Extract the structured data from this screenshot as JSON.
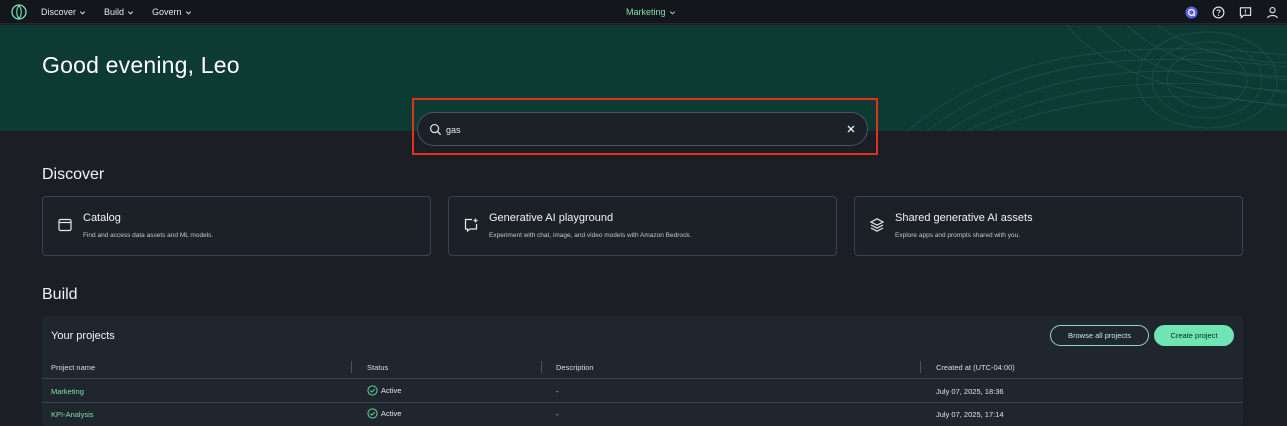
{
  "nav": {
    "items": [
      {
        "label": "Discover"
      },
      {
        "label": "Build"
      },
      {
        "label": "Govern"
      }
    ],
    "project_switch": "Marketing"
  },
  "hero": {
    "greeting": "Good evening, Leo"
  },
  "search": {
    "value": "gas"
  },
  "discover": {
    "title": "Discover",
    "cards": [
      {
        "title": "Catalog",
        "description": "Find and access data assets and ML models.",
        "icon": "catalog-icon"
      },
      {
        "title": "Generative AI playground",
        "description": "Experiment with chat, image, and video models with Amazon Bedrock.",
        "icon": "chat-plus-icon"
      },
      {
        "title": "Shared generative AI assets",
        "description": "Explore apps and prompts shared with you.",
        "icon": "layers-icon"
      }
    ]
  },
  "build": {
    "title": "Build",
    "panel_title": "Your projects",
    "browse_label": "Browse all projects",
    "create_label": "Create project",
    "columns": [
      "Project name",
      "Status",
      "Description",
      "Created at (UTC-04:00)"
    ],
    "rows": [
      {
        "name": "Marketing",
        "status": "Active",
        "description": "-",
        "created": "July 07, 2025, 18:36"
      },
      {
        "name": "KPI-Analysis",
        "status": "Active",
        "description": "-",
        "created": "July 07, 2025, 17:14"
      }
    ]
  },
  "colors": {
    "accent": "#6ee5b3",
    "hero_bg": "#0d3b34",
    "highlight": "#e0301e"
  }
}
